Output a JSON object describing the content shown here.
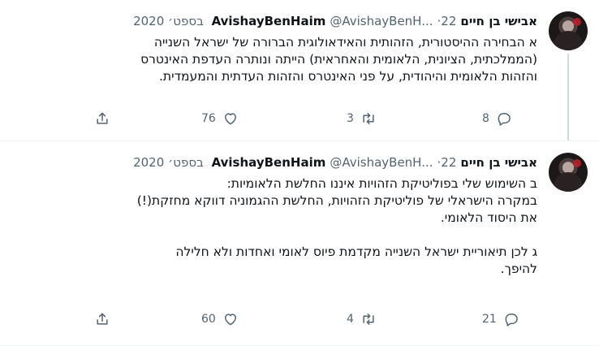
{
  "tweets": [
    {
      "author_name": "אבישי בן חיים",
      "author_handle_name": "AvishayBenHaim",
      "handle": "@AvishayBenH...",
      "separator": "·",
      "date": "22 בספט׳ 2020",
      "lines": [
        "א הבחירה ההיסטורית, הזהותית והאידאולוגית הברורה של ישראל השנייה",
        "(הממלכתית, הציונית, הלאומית והאחראית) הייתה ונותרה העדפת האינטרס",
        "והזהות הלאומית והיהודית, על פני האינטרס והזהות העדתית והמעמדית."
      ],
      "reply_count": "8",
      "retweet_count": "3",
      "like_count": "76"
    },
    {
      "author_name": "אבישי בן חיים",
      "author_handle_name": "AvishayBenHaim",
      "handle": "@AvishayBenH...",
      "separator": "·",
      "date": "22 בספט׳ 2020",
      "lines": [
        "ב השימוש שלי בפוליטיקת הזהויות איננו החלשת הלאומיות:",
        "במקרה הישראלי של פוליטיקת הזהויות, החלשת ההגמוניה דווקא מחזקת(!)",
        "את היסוד הלאומי.",
        "",
        "ג לכן תיאוריית ישראל השנייה מקדמת פיוס לאומי ואחדות ולא חלילה",
        "להיפך."
      ],
      "reply_count": "21",
      "retweet_count": "4",
      "like_count": "60"
    }
  ],
  "icons": {
    "reply": "reply-icon",
    "retweet": "retweet-icon",
    "like": "heart-icon",
    "share": "share-icon"
  },
  "colors": {
    "text": "#0f1419",
    "secondary": "#536471",
    "divider": "#eff3f4",
    "thread_line": "#cfd9de"
  }
}
